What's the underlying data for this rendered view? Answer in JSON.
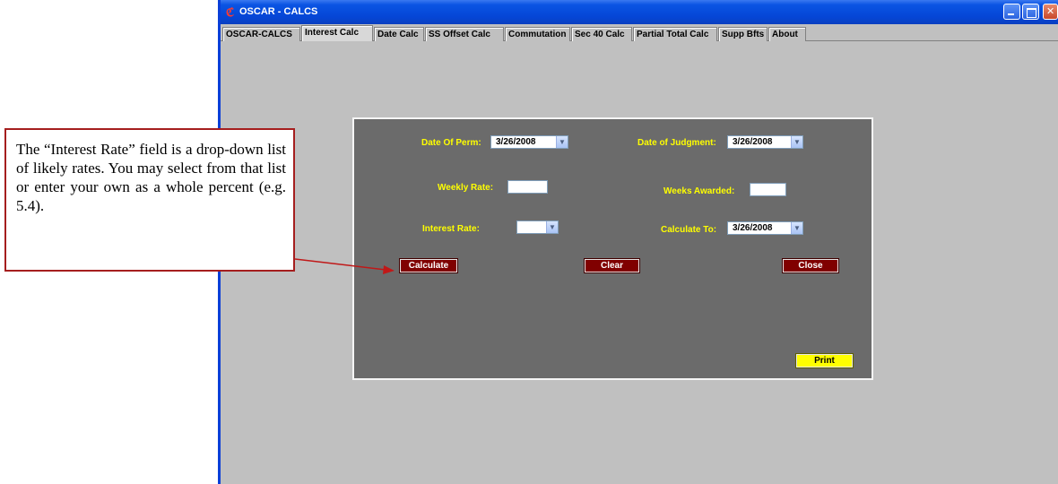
{
  "window": {
    "title": "OSCAR - CALCS",
    "app_icon": "oscar-logo-icon"
  },
  "tabs": [
    {
      "label": "OSCAR-CALCS"
    },
    {
      "label": "Interest Calc"
    },
    {
      "label": "Date Calc"
    },
    {
      "label": "SS Offset Calc"
    },
    {
      "label": "Commutation"
    },
    {
      "label": "Sec 40 Calc"
    },
    {
      "label": "Partial Total Calc"
    },
    {
      "label": "Supp Bfts"
    },
    {
      "label": "About"
    }
  ],
  "active_tab": "Interest Calc",
  "form": {
    "date_of_perm": {
      "label": "Date Of Perm:",
      "value": "3/26/2008"
    },
    "date_of_judgment": {
      "label": "Date of Judgment:",
      "value": "3/26/2008"
    },
    "weekly_rate": {
      "label": "Weekly Rate:",
      "value": ""
    },
    "weeks_awarded": {
      "label": "Weeks Awarded:",
      "value": ""
    },
    "interest_rate": {
      "label": "Interest Rate:",
      "value": ""
    },
    "calculate_to": {
      "label": "Calculate To:",
      "value": "3/26/2008"
    }
  },
  "buttons": {
    "calculate": "Calculate",
    "clear": "Clear",
    "close": "Close",
    "print": "Print"
  },
  "callout": {
    "text": "The “Interest Rate” field is a drop-down list of likely rates. You may select from that list or enter your own as a whole percent (e.g. 5.4)."
  },
  "colors": {
    "panel_bg": "#6b6b6b",
    "label": "#ffff00",
    "button_bg": "#800000",
    "print_bg": "#ffff00",
    "callout_border": "#a51e1e"
  }
}
